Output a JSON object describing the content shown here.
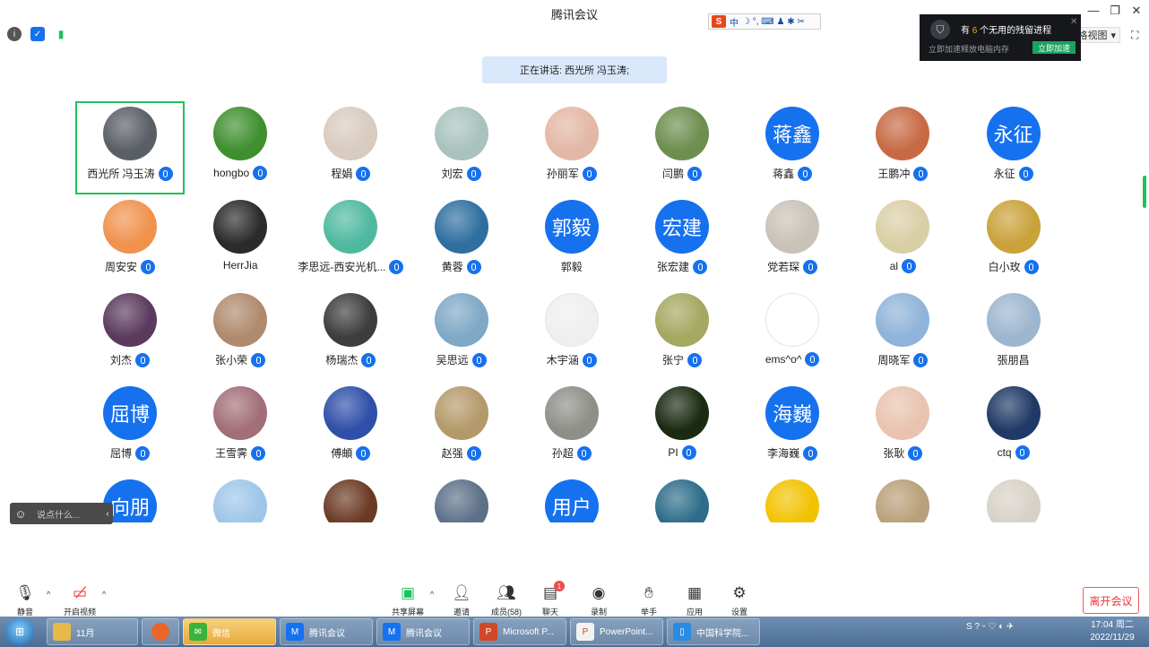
{
  "app": {
    "title": "腾讯会议"
  },
  "window_controls": {
    "minimize": "—",
    "restore": "❐",
    "close": "✕"
  },
  "ime": {
    "logo": "S",
    "mode": "中",
    "icons": "☽ °, ⌨ ♟ ✱ ✂"
  },
  "view": {
    "label": "格视图",
    "caret": "▾",
    "fullscreen": "⛶"
  },
  "notification": {
    "prefix": "有 ",
    "count": "6",
    "suffix": " 个无用的残留进程",
    "sub": "立即加速释放电脑内存",
    "button": "立即加速",
    "close": "✕"
  },
  "speaking": {
    "label": "正在讲话: 西光所 冯玉涛;"
  },
  "participants": [
    {
      "name": "西光所 冯玉涛",
      "avatar": "photo",
      "color": "#5a5f66",
      "mic": true,
      "active": true
    },
    {
      "name": "hongbo",
      "avatar": "photo",
      "color": "#3f8f2f",
      "mic": true
    },
    {
      "name": "程娟",
      "avatar": "photo",
      "color": "#d8cbbf",
      "mic": true
    },
    {
      "name": "刘宏",
      "avatar": "photo",
      "color": "#a9c2bd",
      "mic": true
    },
    {
      "name": "孙丽军",
      "avatar": "photo",
      "color": "#e3b7a5",
      "mic": true
    },
    {
      "name": "闫鹏",
      "avatar": "photo",
      "color": "#6d8e4e",
      "mic": true
    },
    {
      "name": "蒋鑫",
      "avatar": "text",
      "text": "蒋鑫",
      "mic": true
    },
    {
      "name": "王鹏冲",
      "avatar": "photo",
      "color": "#c76a44",
      "mic": true
    },
    {
      "name": "永征",
      "avatar": "text",
      "text": "永征",
      "mic": true
    },
    {
      "name": "周安安",
      "avatar": "photo",
      "color": "#f0924e",
      "mic": true
    },
    {
      "name": "HerrJia",
      "avatar": "photo",
      "color": "#2b2b2b",
      "mic": false
    },
    {
      "name": "李思远-西安光机...",
      "avatar": "photo",
      "color": "#4fb9a0",
      "mic": true
    },
    {
      "name": "黄蓉",
      "avatar": "photo",
      "color": "#2f6fa0",
      "mic": true
    },
    {
      "name": "郭毅",
      "avatar": "text",
      "text": "郭毅",
      "mic": false
    },
    {
      "name": "张宏建",
      "avatar": "text",
      "text": "宏建",
      "mic": true
    },
    {
      "name": "党若琛",
      "avatar": "photo",
      "color": "#c9c2b8",
      "mic": true
    },
    {
      "name": "al",
      "avatar": "photo",
      "color": "#d9cfa5",
      "mic": true
    },
    {
      "name": "白小玫",
      "avatar": "photo",
      "color": "#c9a23a",
      "mic": true
    },
    {
      "name": "刘杰",
      "avatar": "photo",
      "color": "#5b3a5e",
      "mic": true
    },
    {
      "name": "张小荣",
      "avatar": "photo",
      "color": "#b08a6e",
      "mic": true
    },
    {
      "name": "杨瑞杰",
      "avatar": "photo",
      "color": "#3d3d3d",
      "mic": true
    },
    {
      "name": "吴思远",
      "avatar": "photo",
      "color": "#7fa8c6",
      "mic": true
    },
    {
      "name": "木宇涵",
      "avatar": "photo",
      "color": "#efefef",
      "mic": true
    },
    {
      "name": "张宁",
      "avatar": "photo",
      "color": "#a4a860",
      "mic": true
    },
    {
      "name": "ems^o^",
      "avatar": "photo",
      "color": "#ffffff",
      "mic": true
    },
    {
      "name": "周晓军",
      "avatar": "photo",
      "color": "#8fb3d9",
      "mic": true
    },
    {
      "name": "張朋昌",
      "avatar": "photo",
      "color": "#9db6cf",
      "mic": false
    },
    {
      "name": "屈博",
      "avatar": "text",
      "text": "屈博",
      "mic": true
    },
    {
      "name": "王雪霁",
      "avatar": "photo",
      "color": "#a26f78",
      "mic": true
    },
    {
      "name": "傅頔",
      "avatar": "photo",
      "color": "#2f4fa8",
      "mic": true
    },
    {
      "name": "赵强",
      "avatar": "photo",
      "color": "#b49a6a",
      "mic": true
    },
    {
      "name": "孙超",
      "avatar": "photo",
      "color": "#8d8f88",
      "mic": true
    },
    {
      "name": "PI",
      "avatar": "photo",
      "color": "#1b2a12",
      "mic": true
    },
    {
      "name": "李海巍",
      "avatar": "text",
      "text": "海巍",
      "mic": true
    },
    {
      "name": "张耿",
      "avatar": "photo",
      "color": "#e9c3b0",
      "mic": true
    },
    {
      "name": "ctq",
      "avatar": "photo",
      "color": "#1f3a66",
      "mic": true
    },
    {
      "name": "",
      "avatar": "text",
      "text": "向朋",
      "mic": false
    },
    {
      "name": "",
      "avatar": "photo",
      "color": "#9ec6e8",
      "mic": false
    },
    {
      "name": "",
      "avatar": "photo",
      "color": "#6b3a24",
      "mic": false
    },
    {
      "name": "",
      "avatar": "photo",
      "color": "#5d7089",
      "mic": false
    },
    {
      "name": "",
      "avatar": "text",
      "text": "用户",
      "mic": false
    },
    {
      "name": "",
      "avatar": "photo",
      "color": "#2d6d8a",
      "mic": false
    },
    {
      "name": "",
      "avatar": "photo",
      "color": "#f2c200",
      "mic": false
    },
    {
      "name": "",
      "avatar": "photo",
      "color": "#b9a07a",
      "mic": false
    },
    {
      "name": "",
      "avatar": "photo",
      "color": "#d7d2c8",
      "mic": false
    }
  ],
  "chat": {
    "placeholder": "说点什么...",
    "smile": "☺",
    "collapse": "‹"
  },
  "toolbar": {
    "mute": "静音",
    "video": "开启视频",
    "share": "共享屏幕",
    "invite": "邀请",
    "members": "成员(58)",
    "chat": "聊天",
    "chat_badge": "1",
    "record": "录制",
    "raise_hand": "举手",
    "apps": "应用",
    "settings": "设置",
    "leave": "离开会议",
    "caret": "^"
  },
  "taskbar": {
    "start": "⊞",
    "items": [
      "11月",
      "",
      "微信",
      "腾讯会议",
      "腾讯会议",
      "Microsoft P...",
      "PowerPoint...",
      "中国科学院..."
    ],
    "tray": "S ? ᵕ ♡ ◐ ✈",
    "time": "17:04 周二",
    "date": "2022/11/29"
  },
  "colors": {
    "accent": "#1671ef",
    "active_border": "#1ec25a",
    "leave": "#e33333"
  }
}
